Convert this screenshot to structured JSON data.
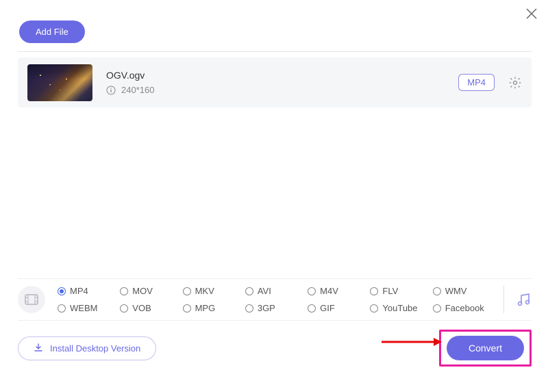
{
  "buttons": {
    "add_file": "Add File",
    "install": "Install Desktop Version",
    "convert": "Convert"
  },
  "file": {
    "name": "OGV.ogv",
    "resolution": "240*160",
    "target_format": "MP4"
  },
  "formats": {
    "row1": [
      "MP4",
      "MOV",
      "MKV",
      "AVI",
      "M4V",
      "FLV",
      "WMV"
    ],
    "row2": [
      "WEBM",
      "VOB",
      "MPG",
      "3GP",
      "GIF",
      "YouTube",
      "Facebook"
    ],
    "selected": "MP4"
  }
}
